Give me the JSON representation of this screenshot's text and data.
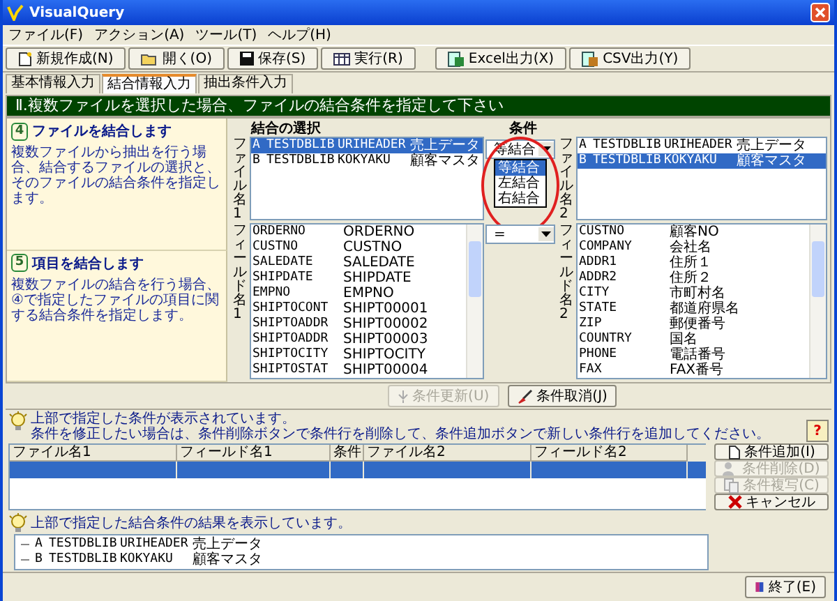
{
  "window": {
    "title": "VisualQuery"
  },
  "menu": [
    "ファイル(F)",
    "アクション(A)",
    "ツール(T)",
    "ヘルプ(H)"
  ],
  "toolbar": [
    "新規作成(N)",
    "開く(O)",
    "保存(S)",
    "実行(R)",
    "Excel出力(X)",
    "CSV出力(Y)"
  ],
  "tabs": [
    {
      "label": "基本情報入力",
      "selected": false
    },
    {
      "label": "結合情報入力",
      "selected": true
    },
    {
      "label": "抽出条件入力",
      "selected": false
    }
  ],
  "header": "Ⅱ.複数ファイルを選択した場合、ファイルの結合条件を指定して下さい",
  "help_sections": [
    {
      "number": "4",
      "title": "ファイルを結合します",
      "text": "複数ファイルから抽出を行う場合、結合するファイルの選択と、そのファイルの結合条件を指定します。"
    },
    {
      "number": "5",
      "title": "項目を結合します",
      "text": "複数ファイルの結合を行う場合、④で指定したファイルの項目に関する結合条件を指定します。"
    }
  ],
  "join": {
    "heading": "結合の選択",
    "file1_label": "ファイル名1",
    "field1_label": "フィールド名1",
    "file2_label": "ファイル名2",
    "field2_label": "フィールド名2",
    "file1_rows": [
      {
        "cells": [
          "A",
          "TESTDBLIB",
          "URIHEADER",
          "売上データ"
        ],
        "selected": true
      },
      {
        "cells": [
          "B",
          "TESTDBLIB",
          "KOKYAKU",
          "顧客マスタ"
        ],
        "selected": false
      }
    ],
    "field1_rows": [
      [
        "ORDERNO",
        "ORDERNO"
      ],
      [
        "CUSTNO",
        "CUSTNO"
      ],
      [
        "SALEDATE",
        "SALEDATE"
      ],
      [
        "SHIPDATE",
        "SHIPDATE"
      ],
      [
        "EMPNO",
        "EMPNO"
      ],
      [
        "SHIPTOCONT",
        "SHIPT00001"
      ],
      [
        "SHIPTOADDR",
        "SHIPT00002"
      ],
      [
        "SHIPTOADDR",
        "SHIPT00003"
      ],
      [
        "SHIPTOCITY",
        "SHIPTOCITY"
      ],
      [
        "SHIPTOSTAT",
        "SHIPT00004"
      ]
    ],
    "condition_label": "条件",
    "join_type": {
      "value": "等結合",
      "expanded": true,
      "highlighted": true,
      "options": [
        {
          "label": "等結合",
          "selected": true
        },
        {
          "label": "左結合",
          "selected": false
        },
        {
          "label": "右結合",
          "selected": false
        }
      ]
    },
    "operator": "=",
    "file2_rows": [
      {
        "cells": [
          "A",
          "TESTDBLIB",
          "URIHEADER",
          "売上データ"
        ],
        "selected": false
      },
      {
        "cells": [
          "B",
          "TESTDBLIB",
          "KOKYAKU",
          "顧客マスタ"
        ],
        "selected": true
      }
    ],
    "field2_rows": [
      [
        "CUSTNO",
        "顧客NO"
      ],
      [
        "COMPANY",
        "会社名"
      ],
      [
        "ADDR1",
        "住所１"
      ],
      [
        "ADDR2",
        "住所２"
      ],
      [
        "CITY",
        "市町村名"
      ],
      [
        "STATE",
        "都道府県名"
      ],
      [
        "ZIP",
        "郵便番号"
      ],
      [
        "COUNTRY",
        "国名"
      ],
      [
        "PHONE",
        "電話番号"
      ],
      [
        "FAX",
        "FAX番号"
      ]
    ]
  },
  "condition_buttons": [
    {
      "label": "条件更新(U)",
      "disabled": true
    },
    {
      "label": "条件取消(J)",
      "disabled": false
    }
  ],
  "info1": [
    "上部で指定した条件が表示されています。",
    "条件を修正したい場合は、条件削除ボタンで条件行を削除して、条件追加ボタンで新しい条件行を追加してください。"
  ],
  "help_button": "?",
  "grid": {
    "columns": [
      "ファイル名1",
      "フィールド名1",
      "条件",
      "ファイル名2",
      "フィールド名2"
    ],
    "rows": [
      {
        "selected": true
      }
    ]
  },
  "side_buttons": [
    {
      "label": "条件追加(I)",
      "disabled": false
    },
    {
      "label": "条件削除(D)",
      "disabled": true
    },
    {
      "label": "条件複写(C)",
      "disabled": true
    },
    {
      "label": "キャンセル",
      "disabled": false
    }
  ],
  "info2": "上部で指定した結合条件の結果を表示しています。",
  "result_tree": [
    {
      "cells": [
        "A",
        "TESTDBLIB",
        "URIHEADER",
        "売上データ"
      ]
    },
    {
      "cells": [
        "B",
        "TESTDBLIB",
        "KOKYAKU",
        "顧客マスタ"
      ]
    }
  ],
  "exit_button": "終了(E)"
}
